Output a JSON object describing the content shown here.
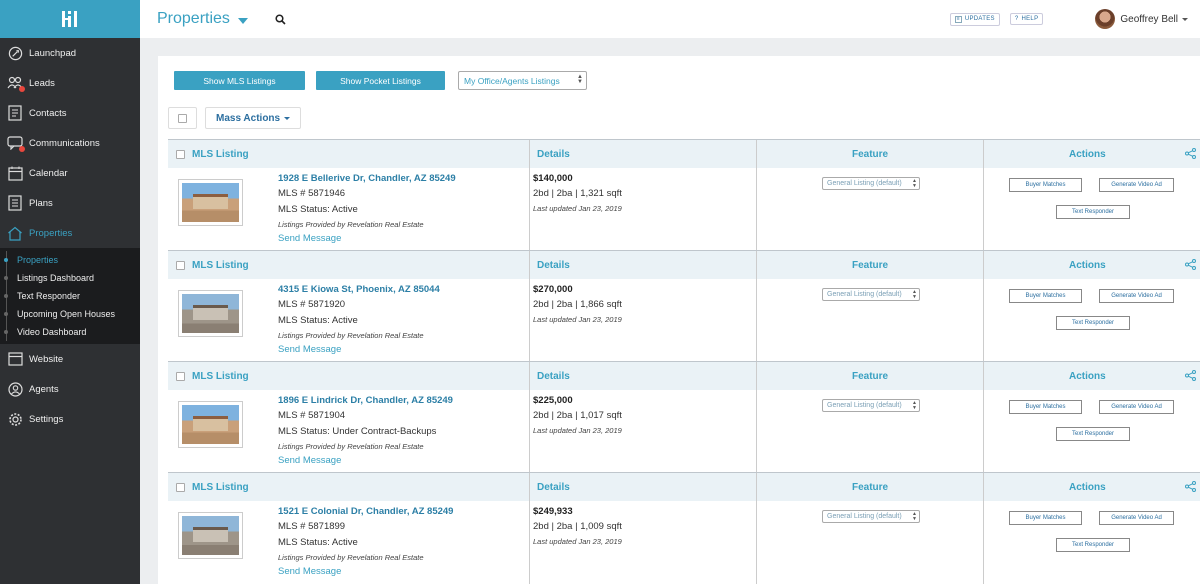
{
  "sidebar": {
    "items": [
      {
        "label": "Launchpad",
        "icon": "rocket-icon"
      },
      {
        "label": "Leads",
        "icon": "people-icon"
      },
      {
        "label": "Contacts",
        "icon": "contacts-icon"
      },
      {
        "label": "Communications",
        "icon": "chat-icon"
      },
      {
        "label": "Calendar",
        "icon": "calendar-icon"
      },
      {
        "label": "Plans",
        "icon": "clipboard-icon"
      },
      {
        "label": "Properties",
        "icon": "house-icon"
      }
    ],
    "submenu": [
      "Properties",
      "Listings Dashboard",
      "Text Responder",
      "Upcoming Open Houses",
      "Video Dashboard"
    ],
    "bottom_items": [
      {
        "label": "Website",
        "icon": "browser-icon"
      },
      {
        "label": "Agents",
        "icon": "agent-icon"
      },
      {
        "label": "Settings",
        "icon": "gear-icon"
      }
    ]
  },
  "header": {
    "title": "Properties",
    "updates_label": "UPDATES",
    "help_label": "HELP",
    "user_name": "Geoffrey Bell"
  },
  "toolbar": {
    "show_mls": "Show MLS Listings",
    "show_pocket": "Show Pocket Listings",
    "office_select": "My Office/Agents Listings",
    "mass_actions": "Mass Actions"
  },
  "table_headers": {
    "mls": "MLS Listing",
    "details": "Details",
    "feature": "Feature",
    "actions": "Actions"
  },
  "action_labels": {
    "buyer_matches": "Buyer Matches",
    "generate_video": "Generate Video Ad",
    "text_responder": "Text Responder"
  },
  "listings": [
    {
      "address": "1928 E Bellerive Dr, Chandler, AZ 85249",
      "mls": "MLS # 5871946",
      "status": "MLS Status: Active",
      "provided": "Listings Provided by Revelation Real Estate",
      "send": "Send Message",
      "price": "$140,000",
      "beds": "2bd | 2ba | 1,321 sqft",
      "updated": "Last updated Jan 23, 2019",
      "feature": "General Listing (default)"
    },
    {
      "address": "4315 E Kiowa St, Phoenix, AZ 85044",
      "mls": "MLS # 5871920",
      "status": "MLS Status: Active",
      "provided": "Listings Provided by Revelation Real Estate",
      "send": "Send Message",
      "price": "$270,000",
      "beds": "2bd | 2ba | 1,866 sqft",
      "updated": "Last updated Jan 23, 2019",
      "feature": "General Listing (default)"
    },
    {
      "address": "1896 E Lindrick Dr, Chandler, AZ 85249",
      "mls": "MLS # 5871904",
      "status": "MLS Status: Under Contract-Backups",
      "provided": "Listings Provided by Revelation Real Estate",
      "send": "Send Message",
      "price": "$225,000",
      "beds": "2bd | 2ba | 1,017 sqft",
      "updated": "Last updated Jan 23, 2019",
      "feature": "General Listing (default)"
    },
    {
      "address": "1521 E Colonial Dr, Chandler, AZ 85249",
      "mls": "MLS # 5871899",
      "status": "MLS Status: Active",
      "provided": "Listings Provided by Revelation Real Estate",
      "send": "Send Message",
      "price": "$249,933",
      "beds": "2bd | 2ba | 1,009 sqft",
      "updated": "Last updated Jan 23, 2019",
      "feature": "General Listing (default)"
    }
  ]
}
